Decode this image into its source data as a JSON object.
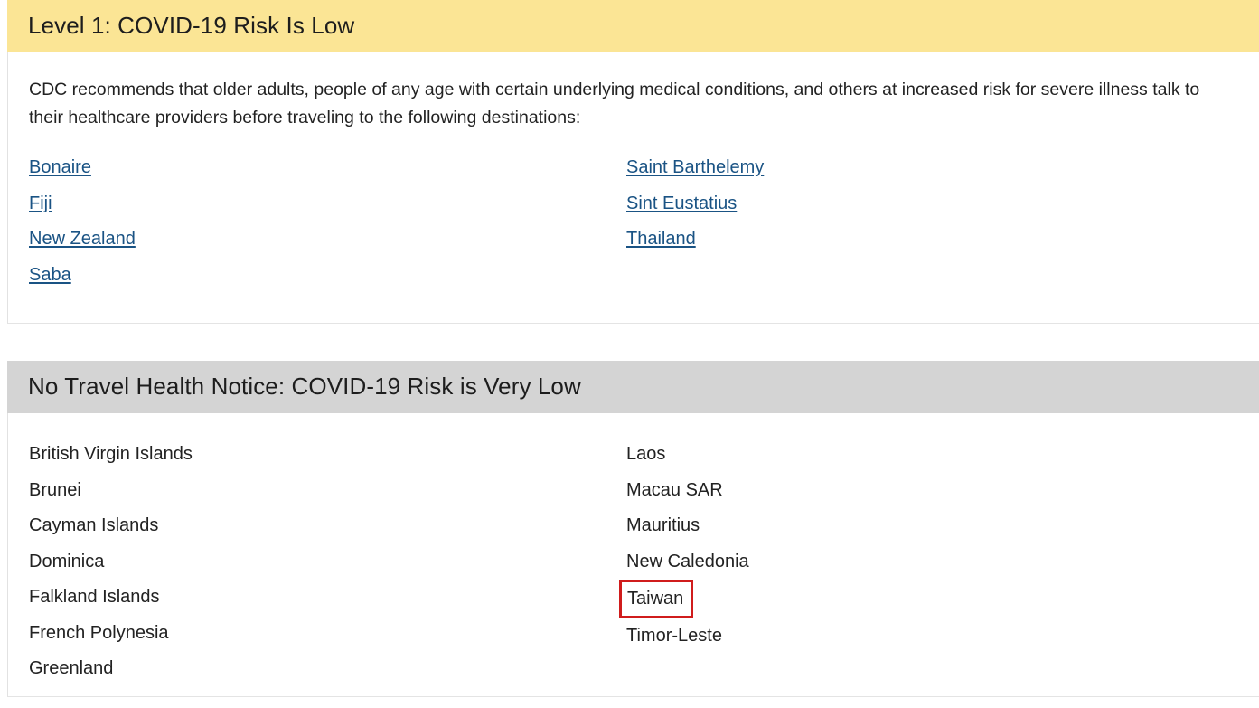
{
  "colors": {
    "level1_header_bg": "#fbe595",
    "notice_header_bg": "#d4d4d4",
    "link": "#1a5384",
    "highlight_border": "#d01c1c",
    "text": "#222222",
    "card_border": "#e4e4e4"
  },
  "sections": [
    {
      "id": "level-1",
      "header": "Level 1: COVID-19 Risk Is Low",
      "header_style": "yellow",
      "intro": "CDC recommends that older adults, people of any age with certain underlying medical conditions, and others at increased risk for severe illness talk to their healthcare providers before traveling to the following destinations:",
      "columns": [
        {
          "items": [
            {
              "label": "Bonaire",
              "link": true,
              "highlighted": false
            },
            {
              "label": "Fiji",
              "link": true,
              "highlighted": false
            },
            {
              "label": "New Zealand",
              "link": true,
              "highlighted": false
            },
            {
              "label": "Saba",
              "link": true,
              "highlighted": false
            }
          ]
        },
        {
          "items": [
            {
              "label": "Saint Barthelemy",
              "link": true,
              "highlighted": false
            },
            {
              "label": "Sint Eustatius",
              "link": true,
              "highlighted": false
            },
            {
              "label": "Thailand",
              "link": true,
              "highlighted": false
            }
          ]
        }
      ]
    },
    {
      "id": "no-notice",
      "header": "No Travel Health Notice: COVID-19 Risk is Very Low",
      "header_style": "gray",
      "intro": "",
      "columns": [
        {
          "items": [
            {
              "label": "British Virgin Islands",
              "link": false,
              "highlighted": false
            },
            {
              "label": "Brunei",
              "link": false,
              "highlighted": false
            },
            {
              "label": "Cayman Islands",
              "link": false,
              "highlighted": false
            },
            {
              "label": "Dominica",
              "link": false,
              "highlighted": false
            },
            {
              "label": "Falkland Islands",
              "link": false,
              "highlighted": false
            },
            {
              "label": "French Polynesia",
              "link": false,
              "highlighted": false
            },
            {
              "label": "Greenland",
              "link": false,
              "highlighted": false
            }
          ]
        },
        {
          "items": [
            {
              "label": "Laos",
              "link": false,
              "highlighted": false
            },
            {
              "label": "Macau SAR",
              "link": false,
              "highlighted": false
            },
            {
              "label": "Mauritius",
              "link": false,
              "highlighted": false
            },
            {
              "label": "New Caledonia",
              "link": false,
              "highlighted": false
            },
            {
              "label": "Taiwan",
              "link": false,
              "highlighted": true
            },
            {
              "label": "Timor-Leste",
              "link": false,
              "highlighted": false
            }
          ]
        }
      ]
    }
  ]
}
